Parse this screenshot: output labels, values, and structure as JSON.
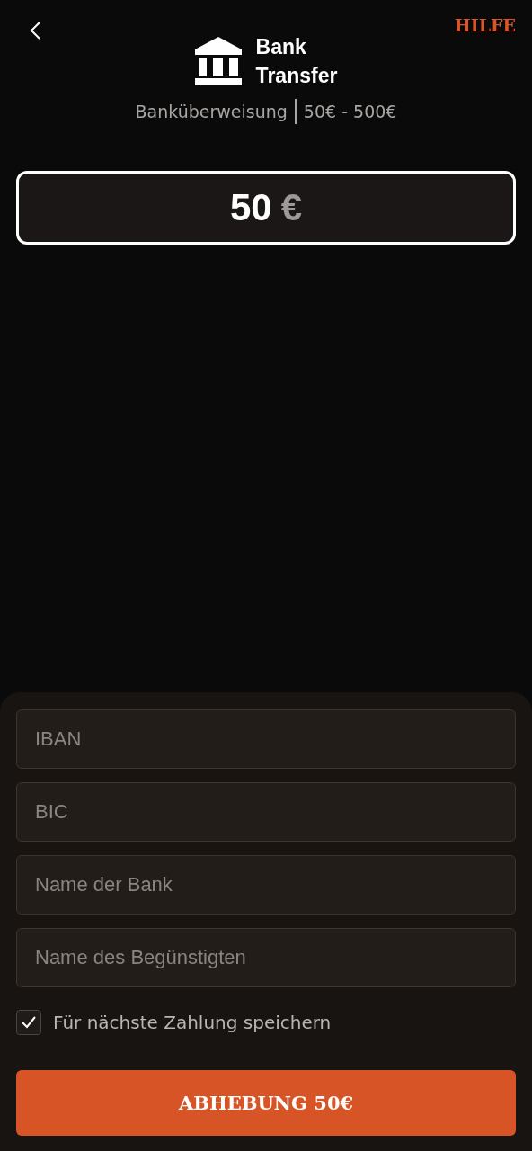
{
  "header": {
    "help": "HILFE",
    "title_line_1": "Bank",
    "title_line_2": "Transfer",
    "method": "Banküberweisung",
    "range": "50€ - 500€"
  },
  "amount": {
    "value": "50",
    "currency": "€"
  },
  "fields": [
    {
      "placeholder": "IBAN"
    },
    {
      "placeholder": "BIC"
    },
    {
      "placeholder": "Name der Bank"
    },
    {
      "placeholder": "Name des Begünstigten"
    }
  ],
  "save": {
    "label": "Für nächste Zahlung speichern",
    "checked": true
  },
  "submit": "ABHEBUNG 50€"
}
